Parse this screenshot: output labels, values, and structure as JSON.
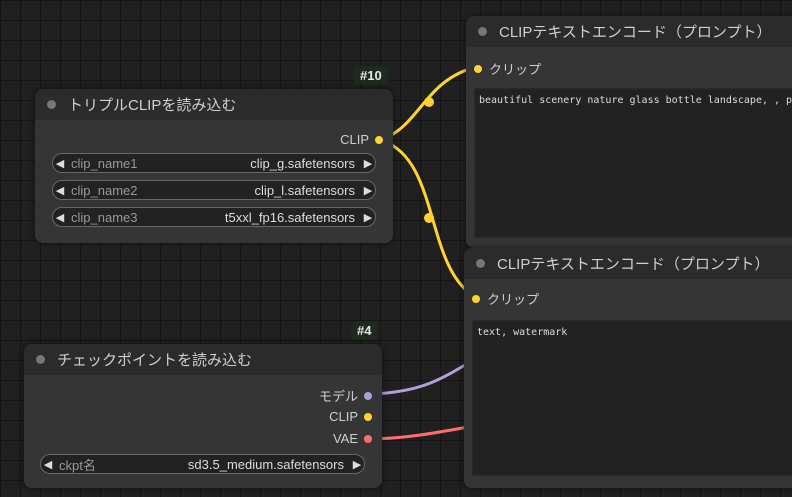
{
  "colors": {
    "clip_wire": "#ffd233",
    "model_wire": "#b39ddb",
    "vae_wire": "#ff6e6e"
  },
  "triple_clip": {
    "badge": "#10",
    "title": "トリプルCLIPを読み込む",
    "output_clip": "CLIP",
    "widgets": [
      {
        "label": "clip_name1",
        "value": "clip_g.safetensors"
      },
      {
        "label": "clip_name2",
        "value": "clip_l.safetensors"
      },
      {
        "label": "clip_name3",
        "value": "t5xxl_fp16.safetensors"
      }
    ]
  },
  "checkpoint": {
    "badge": "#4",
    "title": "チェックポイントを読み込む",
    "outputs": {
      "model": "モデル",
      "clip": "CLIP",
      "vae": "VAE"
    },
    "widget": {
      "label": "ckpt名",
      "value": "sd3.5_medium.safetensors"
    }
  },
  "encode_positive": {
    "title": "CLIPテキストエンコード（プロンプト）",
    "input_clip": "クリップ",
    "text": "beautiful scenery nature glass bottle landscape, , purp"
  },
  "encode_negative": {
    "title": "CLIPテキストエンコード（プロンプト）",
    "input_clip": "クリップ",
    "text": "text, watermark"
  }
}
